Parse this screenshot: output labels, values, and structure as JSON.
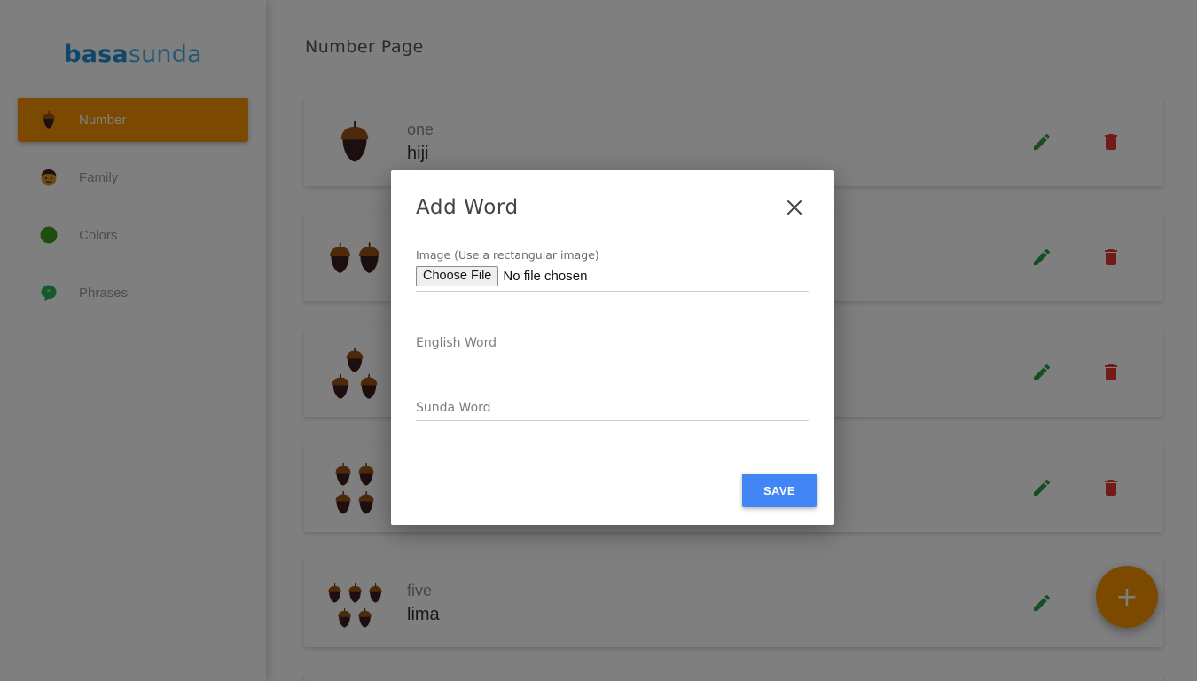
{
  "sidebar": {
    "brand_part1": "basa",
    "brand_part2": "sunda",
    "items": [
      {
        "label": "Number",
        "icon": "acorn-icon",
        "active": true
      },
      {
        "label": "Family",
        "icon": "boy-face-icon",
        "active": false
      },
      {
        "label": "Colors",
        "icon": "green-circle-icon",
        "active": false
      },
      {
        "label": "Phrases",
        "icon": "chat-bubble-icon",
        "active": false
      }
    ]
  },
  "main": {
    "title": "Number Page",
    "cards": [
      {
        "english": "one",
        "sunda": "hiji",
        "acorns": 1
      },
      {
        "english": "",
        "sunda": "",
        "acorns": 2
      },
      {
        "english": "",
        "sunda": "",
        "acorns": 3
      },
      {
        "english": "",
        "sunda": "",
        "acorns": 4
      },
      {
        "english": "five",
        "sunda": "lima",
        "acorns": 5
      }
    ],
    "fab_label": "+"
  },
  "modal": {
    "title": "Add Word",
    "image_label": "Image (Use a rectangular image)",
    "file_button": "Choose File",
    "file_status": "No file chosen",
    "english_placeholder": "English Word",
    "sunda_placeholder": "Sunda Word",
    "save_label": "SAVE"
  },
  "colors": {
    "accent": "#f79500",
    "brand": "#1f8fd6",
    "edit": "#2e9c4a",
    "delete": "#e53935",
    "save": "#4285f4"
  }
}
